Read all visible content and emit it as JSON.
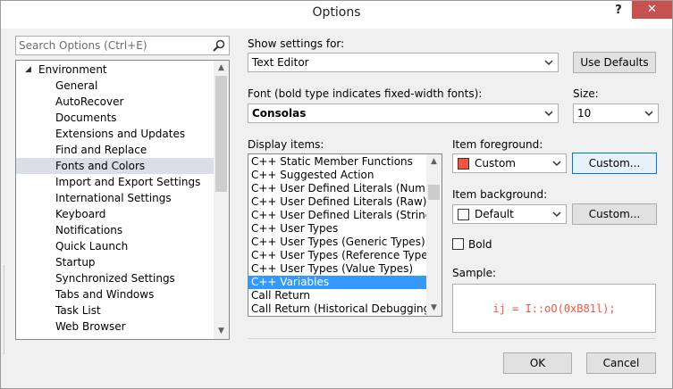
{
  "window": {
    "title": "Options",
    "help_label": "?",
    "close_label": "✕"
  },
  "search": {
    "placeholder": "Search Options (Ctrl+E)",
    "icon": "search-icon"
  },
  "tree": {
    "root": {
      "label": "Environment",
      "expanded": true
    },
    "items": [
      "General",
      "AutoRecover",
      "Documents",
      "Extensions and Updates",
      "Find and Replace",
      "Fonts and Colors",
      "Import and Export Settings",
      "International Settings",
      "Keyboard",
      "Notifications",
      "Quick Launch",
      "Startup",
      "Synchronized Settings",
      "Tabs and Windows",
      "Task List",
      "Web Browser"
    ],
    "selected": "Fonts and Colors"
  },
  "show_settings": {
    "label": "Show settings for:",
    "value": "Text Editor",
    "use_defaults": "Use Defaults"
  },
  "font": {
    "label": "Font (bold type indicates fixed-width fonts):",
    "value": "Consolas"
  },
  "size": {
    "label": "Size:",
    "value": "10"
  },
  "display_items": {
    "label": "Display items:",
    "items": [
      "C++ Static Member Functions",
      "C++ Suggested Action",
      "C++ User Defined Literals (Number)",
      "C++ User Defined Literals (Raw)",
      "C++ User Defined Literals (String)",
      "C++ User Types",
      "C++ User Types (Generic Types)",
      "C++ User Types (Reference Types)",
      "C++ User Types (Value Types)",
      "C++ Variables",
      "Call Return",
      "Call Return (Historical Debugging)"
    ],
    "selected": "C++ Variables"
  },
  "foreground": {
    "label": "Item foreground:",
    "value": "Custom",
    "swatch_color": "#f35340",
    "button": "Custom..."
  },
  "background": {
    "label": "Item background:",
    "value": "Default",
    "swatch_color": "#ffffff",
    "button": "Custom..."
  },
  "bold": {
    "label": "Bold",
    "checked": false
  },
  "sample": {
    "label": "Sample:",
    "text": "ij = I::oO(0xB81l);",
    "color": "#f35340"
  },
  "footer": {
    "ok": "OK",
    "cancel": "Cancel"
  }
}
